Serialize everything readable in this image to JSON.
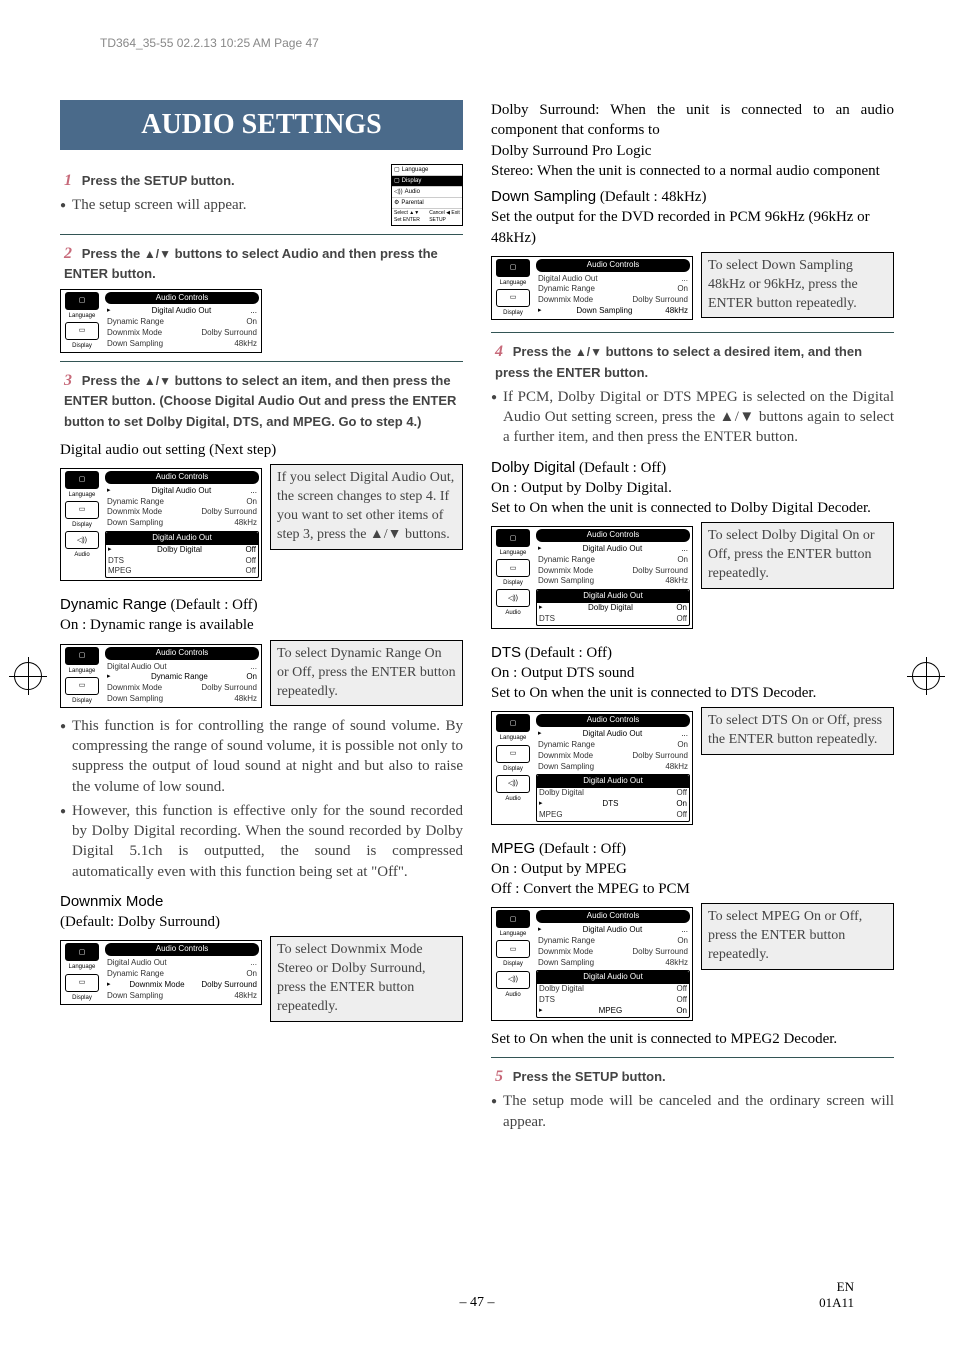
{
  "doc_header": "TD364_35-55  02.2.13  10:25 AM  Page 47",
  "title": "AUDIO SETTINGS",
  "step1_label": "Press the SETUP button.",
  "step1_note": "The setup screen will appear.",
  "step2_label_a": "Press the ",
  "step2_label_b": " buttons to select Audio and then press the ENTER button.",
  "screen1": {
    "title": "Audio Controls",
    "rows": [
      {
        "l": "Digital Audio Out",
        "r": "...",
        "hl": true
      },
      {
        "l": "Dynamic Range",
        "r": "On"
      },
      {
        "l": "Downmix Mode",
        "r": "Dolby Surround"
      },
      {
        "l": "Down Sampling",
        "r": "48kHz"
      }
    ],
    "side": [
      "Language",
      "Display"
    ]
  },
  "step3_label_a": "Press the ",
  "step3_label_b": " buttons to select an item, and then press the ENTER button. (Choose Digital Audio Out and press the ENTER button to set Dolby Digital, DTS, and MPEG.  Go to step 4.)",
  "digital_out_heading": "Digital audio out setting (Next step)",
  "screen2": {
    "title": "Audio Controls",
    "rows": [
      {
        "l": "Digital Audio Out",
        "r": "...",
        "hl": true
      },
      {
        "l": "Dynamic Range",
        "r": "On"
      },
      {
        "l": "Downmix Mode",
        "r": "Dolby Surround"
      },
      {
        "l": "Down Sampling",
        "r": "48kHz"
      }
    ],
    "sub_title": "Digital Audio Out",
    "sub_rows": [
      {
        "l": "Dolby Digital",
        "r": "Off",
        "hl": true
      },
      {
        "l": "DTS",
        "r": "Off"
      },
      {
        "l": "MPEG",
        "r": "Off"
      }
    ],
    "side": [
      "Language",
      "Display",
      "Audio"
    ]
  },
  "digital_out_side": "If you select Digital Audio Out, the screen changes to step 4. If you want to set other items of step 3, press the ▲/▼ buttons.",
  "dyn_range_title": "Dynamic Range",
  "dyn_range_default": " (Default : Off)",
  "dyn_range_on": "On : Dynamic range is available",
  "screen3": {
    "title": "Audio Controls",
    "rows": [
      {
        "l": "Digital Audio Out",
        "r": "..."
      },
      {
        "l": "Dynamic Range",
        "r": "On",
        "hl": true
      },
      {
        "l": "Downmix Mode",
        "r": "Dolby Surround"
      },
      {
        "l": "Down Sampling",
        "r": "48kHz"
      }
    ],
    "side": [
      "Language",
      "Display"
    ]
  },
  "dyn_range_side": "To select Dynamic Range On or Off, press the ENTER button repeatedly.",
  "dyn_range_p1": "This function is for controlling the range of sound volume.  By compressing the range of sound volume, it is possible not only to suppress the output of loud sound at night and but also to raise the volume of low sound.",
  "dyn_range_p2": "However, this function is effective only for the sound recorded by Dolby Digital recording.  When the sound recorded by Dolby Digital 5.1ch is outputted, the sound is compressed automatically even with this function being set at \"Off\".",
  "downmix_title": "Downmix Mode",
  "downmix_default": "(Default: Dolby Surround)",
  "screen4": {
    "title": "Audio Controls",
    "rows": [
      {
        "l": "Digital Audio Out",
        "r": "..."
      },
      {
        "l": "Dynamic Range",
        "r": "On"
      },
      {
        "l": "Downmix Mode",
        "r": "Dolby Surround",
        "hl": true
      },
      {
        "l": "Down Sampling",
        "r": "48kHz"
      }
    ],
    "side": [
      "Language",
      "Display"
    ]
  },
  "downmix_side": "To select Downmix Mode Stereo or Dolby Surround, press the ENTER button repeatedly.",
  "r_dolby_sur": "Dolby Surround: When the unit is connected to an audio component that conforms to",
  "r_dolby_pro": "Dolby Surround Pro Logic",
  "r_stereo": "Stereo: When the unit is connected to a normal audio component",
  "downsamp_title": "Down Sampling",
  "downsamp_default": " (Default : 48kHz)",
  "downsamp_desc": "Set the output for the DVD recorded in PCM 96kHz (96kHz or 48kHz)",
  "screen5": {
    "title": "Audio Controls",
    "rows": [
      {
        "l": "Digital Audio Out",
        "r": "..."
      },
      {
        "l": "Dynamic Range",
        "r": "On"
      },
      {
        "l": "Downmix Mode",
        "r": "Dolby Surround"
      },
      {
        "l": "Down Sampling",
        "r": "48kHz",
        "hl": true
      }
    ],
    "side": [
      "Language",
      "Display"
    ]
  },
  "downsamp_side": "To select Down Sampling 48kHz or 96kHz, press the ENTER button repeatedly.",
  "step4_label_a": "Press the ",
  "step4_label_b": " buttons to select a desired item, and then press the ENTER button.",
  "step4_note": "If PCM, Dolby Digital or DTS MPEG is selected on the Digital Audio Out setting screen, press the ▲/▼ buttons again to select a further item, and then press the ENTER button.",
  "dolby_title": "Dolby Digital",
  "dolby_default": " (Default : Off)",
  "dolby_on": "On : Output by Dolby Digital.",
  "dolby_desc": "Set to On when the unit is connected to Dolby Digital Decoder.",
  "screen6": {
    "title": "Audio Controls",
    "rows": [
      {
        "l": "Digital Audio Out",
        "r": "...",
        "hl": true
      },
      {
        "l": "Dynamic Range",
        "r": "On"
      },
      {
        "l": "Downmix Mode",
        "r": "Dolby Surround"
      },
      {
        "l": "Down Sampling",
        "r": "48kHz"
      }
    ],
    "sub_title": "Digital Audio Out",
    "sub_rows": [
      {
        "l": "Dolby Digital",
        "r": "On",
        "hl": true
      },
      {
        "l": "DTS",
        "r": "Off"
      }
    ],
    "side": [
      "Language",
      "Display",
      "Audio"
    ]
  },
  "dolby_side": "To select Dolby Digital On or Off, press the ENTER button repeatedly.",
  "dts_title": "DTS",
  "dts_default": " (Default : Off)",
  "dts_on": "On : Output DTS sound",
  "dts_desc": "Set to On when the unit is connected to DTS Decoder.",
  "screen7": {
    "title": "Audio Controls",
    "rows": [
      {
        "l": "Digital Audio Out",
        "r": "...",
        "hl": true
      },
      {
        "l": "Dynamic Range",
        "r": "On"
      },
      {
        "l": "Downmix Mode",
        "r": "Dolby Surround"
      },
      {
        "l": "Down Sampling",
        "r": "48kHz"
      }
    ],
    "sub_title": "Digital Audio Out",
    "sub_rows": [
      {
        "l": "Dolby Digital",
        "r": "Off"
      },
      {
        "l": "DTS",
        "r": "On",
        "hl": true
      },
      {
        "l": "MPEG",
        "r": "Off"
      }
    ],
    "side": [
      "Language",
      "Display",
      "Audio"
    ]
  },
  "dts_side": "To select DTS On or Off, press the ENTER button repeatedly.",
  "mpeg_title": "MPEG",
  "mpeg_default": " (Default : Off)",
  "mpeg_on": "On : Output by MPEG",
  "mpeg_off": "Off : Convert the MPEG to PCM",
  "screen8": {
    "title": "Audio Controls",
    "rows": [
      {
        "l": "Digital Audio Out",
        "r": "...",
        "hl": true
      },
      {
        "l": "Dynamic Range",
        "r": "On"
      },
      {
        "l": "Downmix Mode",
        "r": "Dolby Surround"
      },
      {
        "l": "Down Sampling",
        "r": "48kHz"
      }
    ],
    "sub_title": "Digital Audio Out",
    "sub_rows": [
      {
        "l": "Dolby Digital",
        "r": "Off"
      },
      {
        "l": "DTS",
        "r": "Off"
      },
      {
        "l": "MPEG",
        "r": "On",
        "hl": true
      }
    ],
    "side": [
      "Language",
      "Display",
      "Audio"
    ]
  },
  "mpeg_side": "To select MPEG On or Off, press the ENTER button repeatedly.",
  "mpeg_desc": "Set to On when the unit is connected to MPEG2 Decoder.",
  "step5_label": "Press the SETUP button.",
  "step5_note": "The setup mode will be canceled and the ordinary screen will appear.",
  "page_num": "– 47 –",
  "footer_r1": "EN",
  "footer_r2": "01A11"
}
